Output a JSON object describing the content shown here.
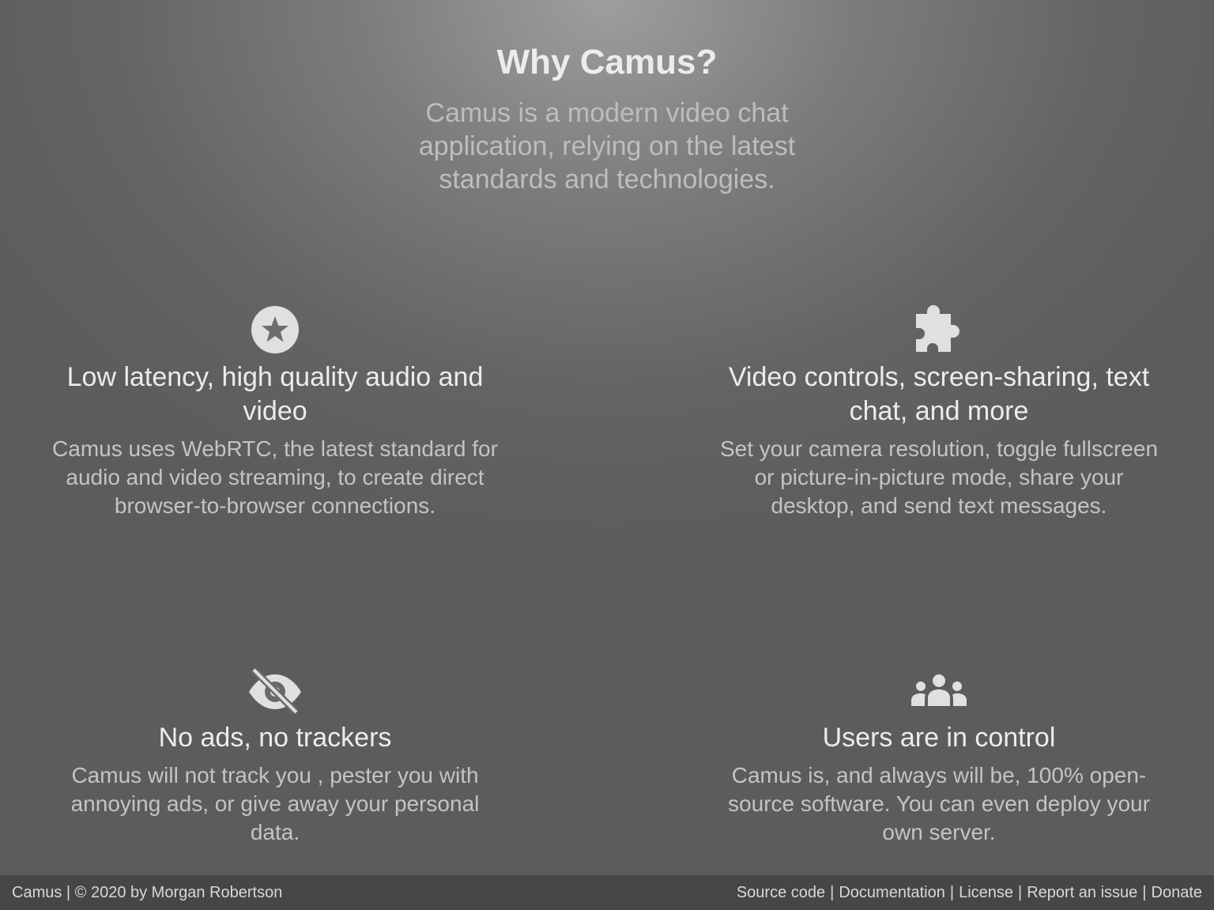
{
  "hero": {
    "title": "Why Camus?",
    "subtitle": "Camus is a modern video chat application, relying on the latest standards and technologies."
  },
  "features": [
    {
      "icon": "star-circle-icon",
      "title": "Low latency, high quality audio and video",
      "description": "Camus uses WebRTC, the latest standard for audio and video streaming, to create direct browser-to-browser connections."
    },
    {
      "icon": "puzzle-piece-icon",
      "title": "Video controls, screen-sharing, text chat, and more",
      "description": "Set your camera resolution, toggle fullscreen or picture-in-picture mode, share your desktop, and send text messages."
    },
    {
      "icon": "eye-slash-icon",
      "title": "No ads, no trackers",
      "description": "Camus will not track you , pester you with annoying ads, or give away your personal data."
    },
    {
      "icon": "users-icon",
      "title": "Users are in control",
      "description": "Camus is, and always will be, 100% open-source software. You can even deploy your own server."
    }
  ],
  "footer": {
    "copyright": "Camus | © 2020 by Morgan Robertson",
    "links": [
      "Source code",
      "Documentation",
      "License",
      "Report an issue",
      "Donate"
    ],
    "separator": "|"
  },
  "colors": {
    "icon": "#e0e0e0",
    "footer_bg": "#464646"
  }
}
